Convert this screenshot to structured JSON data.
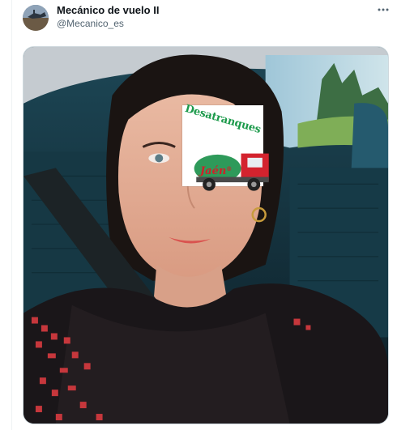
{
  "tweet": {
    "display_name": "Mecánico de vuelo II",
    "handle": "@Mecanico_es",
    "more_icon": "more-horizontal-icon"
  },
  "media": {
    "kind": "photo",
    "sticker": {
      "title": "Desatranques",
      "subtitle": "Jaén",
      "registered_mark": "®",
      "colors": {
        "title": "#1c9a4b",
        "subtitle": "#d0202a"
      }
    }
  }
}
